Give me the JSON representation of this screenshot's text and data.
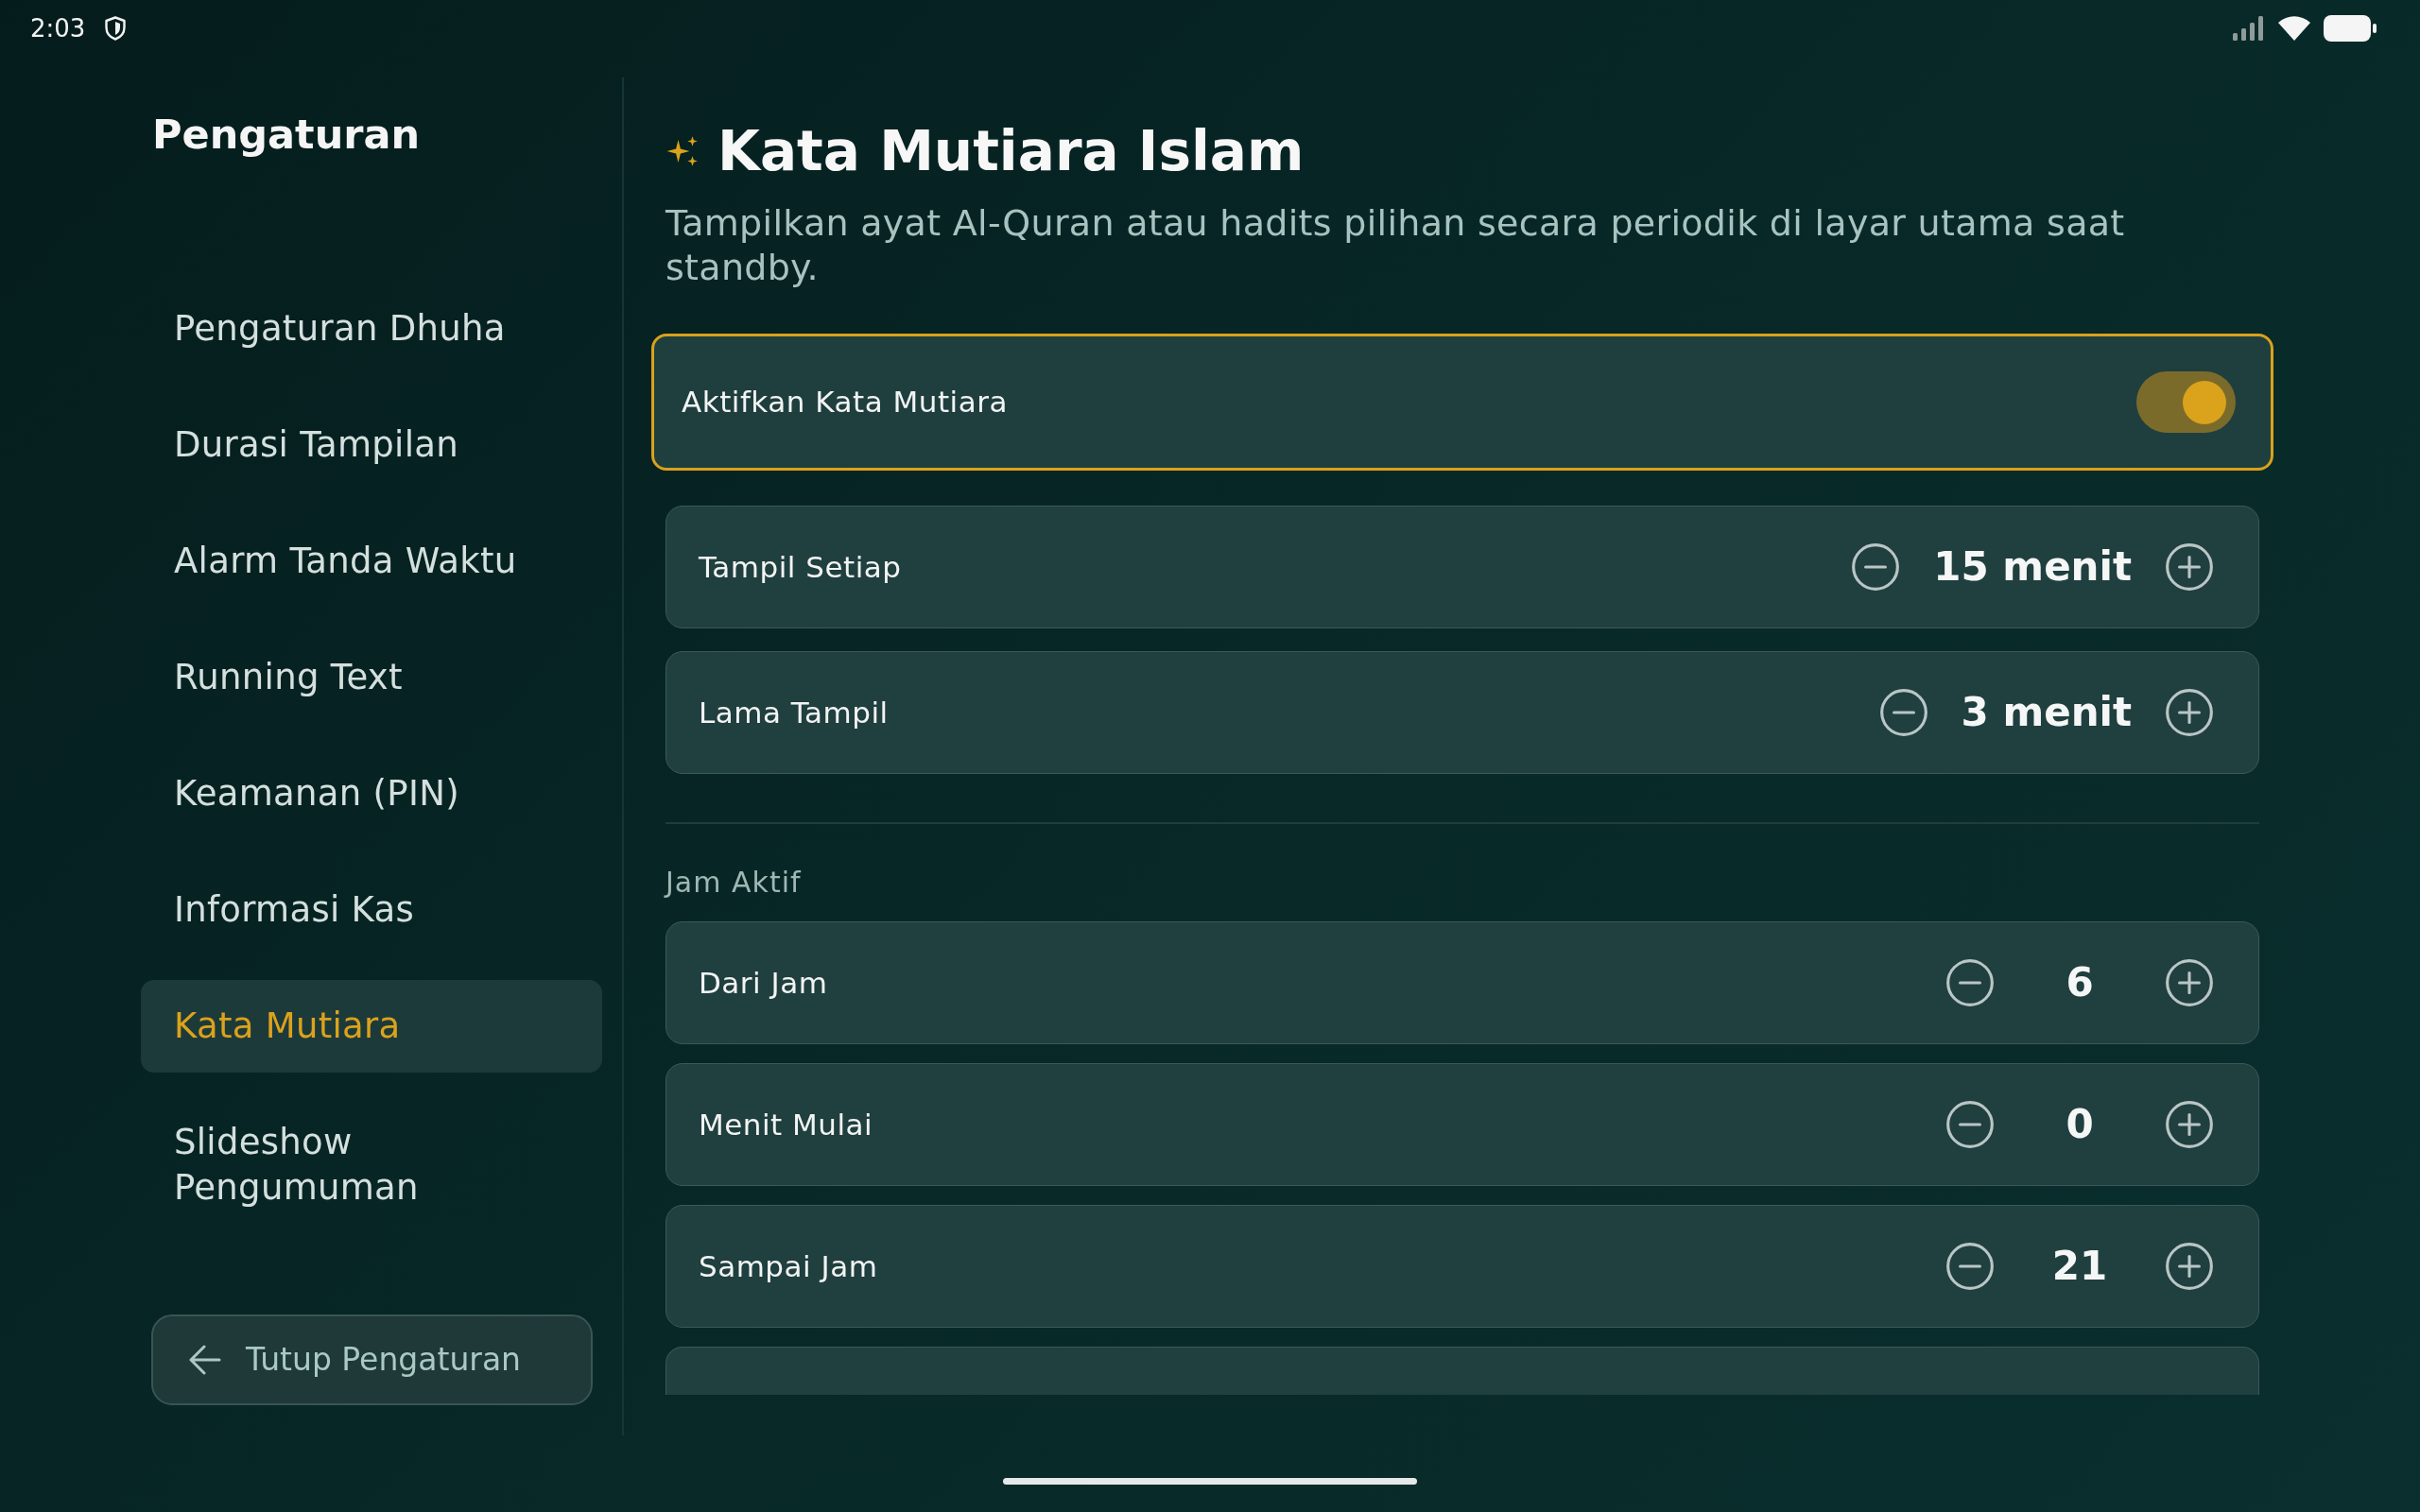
{
  "status_bar": {
    "time": "2:03"
  },
  "sidebar": {
    "title": "Pengaturan",
    "items": [
      {
        "label": "Pengaturan Dhuha",
        "selected": false
      },
      {
        "label": "Durasi Tampilan",
        "selected": false
      },
      {
        "label": "Alarm Tanda Waktu",
        "selected": false
      },
      {
        "label": "Running Text",
        "selected": false
      },
      {
        "label": "Keamanan (PIN)",
        "selected": false
      },
      {
        "label": "Informasi Kas",
        "selected": false
      },
      {
        "label": "Kata Mutiara",
        "selected": true
      },
      {
        "label": "Slideshow Pengumuman",
        "selected": false
      }
    ],
    "close_button": "Tutup Pengaturan"
  },
  "content": {
    "title": "Kata Mutiara Islam",
    "description": "Tampilkan ayat Al-Quran atau hadits pilihan secara periodik di layar utama saat standby.",
    "toggle": {
      "label": "Aktifkan Kata Mutiara",
      "on": true
    },
    "interval_rows": [
      {
        "label": "Tampil Setiap",
        "value": "15 menit"
      },
      {
        "label": "Lama Tampil",
        "value": "3 menit"
      }
    ],
    "section_title": "Jam Aktif",
    "time_rows": [
      {
        "label": "Dari Jam",
        "value": "6"
      },
      {
        "label": "Menit Mulai",
        "value": "0"
      },
      {
        "label": "Sampai Jam",
        "value": "21"
      }
    ]
  }
}
